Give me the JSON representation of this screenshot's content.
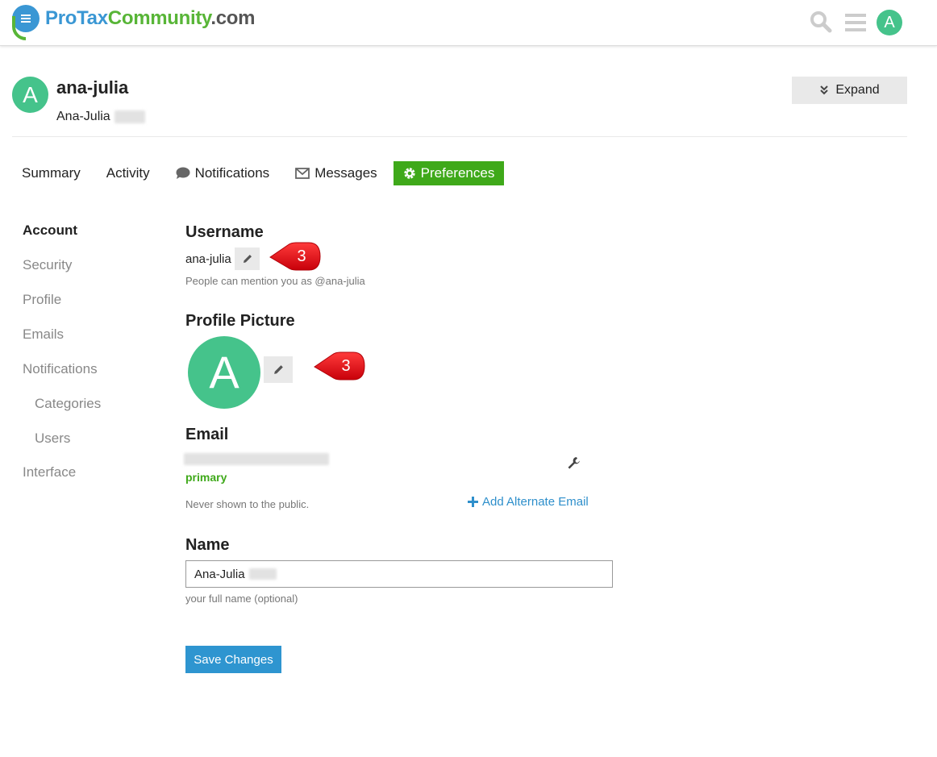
{
  "header": {
    "logo_part1": "ProTax",
    "logo_part2": "Community",
    "logo_part3": ".com",
    "avatar_letter": "A",
    "icons": [
      "search-icon",
      "hamburger-icon"
    ]
  },
  "user": {
    "avatar_letter": "A",
    "username": "ana-julia",
    "full_name": "Ana-Julia",
    "expand_label": "Expand"
  },
  "tabs": [
    {
      "label": "Summary",
      "icon": null,
      "active": false
    },
    {
      "label": "Activity",
      "icon": null,
      "active": false
    },
    {
      "label": "Notifications",
      "icon": "chat-bubble-icon",
      "active": false
    },
    {
      "label": "Messages",
      "icon": "envelope-icon",
      "active": false
    },
    {
      "label": "Preferences",
      "icon": "gear-icon",
      "active": true
    }
  ],
  "sidenav": {
    "items": [
      {
        "label": "Account",
        "active": true
      },
      {
        "label": "Security"
      },
      {
        "label": "Profile"
      },
      {
        "label": "Emails"
      },
      {
        "label": "Notifications"
      },
      {
        "label": "Categories",
        "sub": true
      },
      {
        "label": "Users",
        "sub": true
      },
      {
        "label": "Interface"
      }
    ]
  },
  "username_section": {
    "title": "Username",
    "value": "ana-julia",
    "hint": "People can mention you as @ana-julia",
    "callout": "3"
  },
  "profile_picture_section": {
    "title": "Profile Picture",
    "avatar_letter": "A",
    "callout": "3"
  },
  "email_section": {
    "title": "Email",
    "primary_label": "primary",
    "hint": "Never shown to the public.",
    "add_alternate_label": "Add Alternate Email"
  },
  "name_section": {
    "title": "Name",
    "value": "Ana-Julia",
    "hint": "your full name (optional)"
  },
  "save_label": "Save Changes",
  "colors": {
    "brand_blue": "#3a97d4",
    "brand_green": "#58b537",
    "avatar_green": "#45c38b",
    "active_tab": "#3fa91a",
    "save_button": "#2e95d0",
    "callout_red": "#e8121b"
  }
}
